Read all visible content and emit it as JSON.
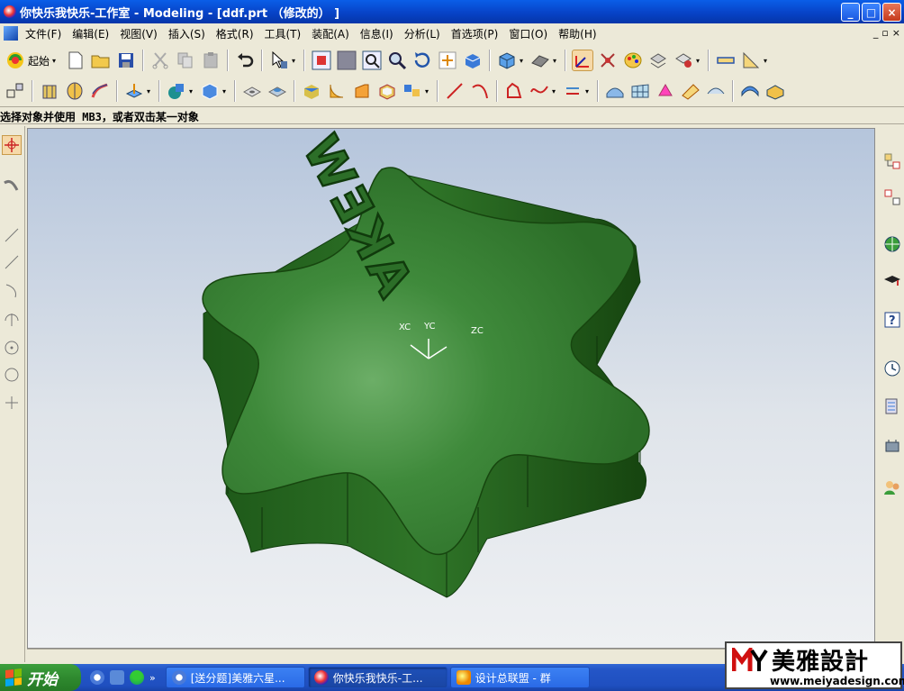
{
  "window": {
    "title": "你快乐我快乐-工作室 - Modeling - [ddf.prt （修改的） ]",
    "minimize": "_",
    "maximize": "□",
    "close": "×"
  },
  "menu": {
    "items": [
      {
        "label": "文件(F)"
      },
      {
        "label": "编辑(E)"
      },
      {
        "label": "视图(V)"
      },
      {
        "label": "插入(S)"
      },
      {
        "label": "格式(R)"
      },
      {
        "label": "工具(T)"
      },
      {
        "label": "装配(A)"
      },
      {
        "label": "信息(I)"
      },
      {
        "label": "分析(L)"
      },
      {
        "label": "首选项(P)"
      },
      {
        "label": "窗口(O)"
      },
      {
        "label": "帮助(H)"
      }
    ],
    "doc_controls": [
      "_",
      "▫",
      "×"
    ]
  },
  "toolbar": {
    "start_label": "起始"
  },
  "cue_line": "选择对象并使用 MB3，或者双击某一对象",
  "viewport": {
    "model_text": "AKEW",
    "axis_labels": {
      "xc": "XC",
      "yc": "YC",
      "zc": "ZC"
    },
    "colors": {
      "model_top": "#2f7a2f",
      "model_side": "#1f5a1c",
      "background_top": "#b5c5dc"
    }
  },
  "taskbar": {
    "start_label": "开始",
    "tasks": [
      {
        "label": "[送分题]美雅六星...",
        "icon": "browser-icon"
      },
      {
        "label": "你快乐我快乐-工...",
        "icon": "nx-icon",
        "active": true
      },
      {
        "label": "设计总联盟 - 群",
        "icon": "chat-icon"
      }
    ]
  },
  "watermark": {
    "brand": "美雅設計",
    "url": "www.meiyadesign.com"
  }
}
